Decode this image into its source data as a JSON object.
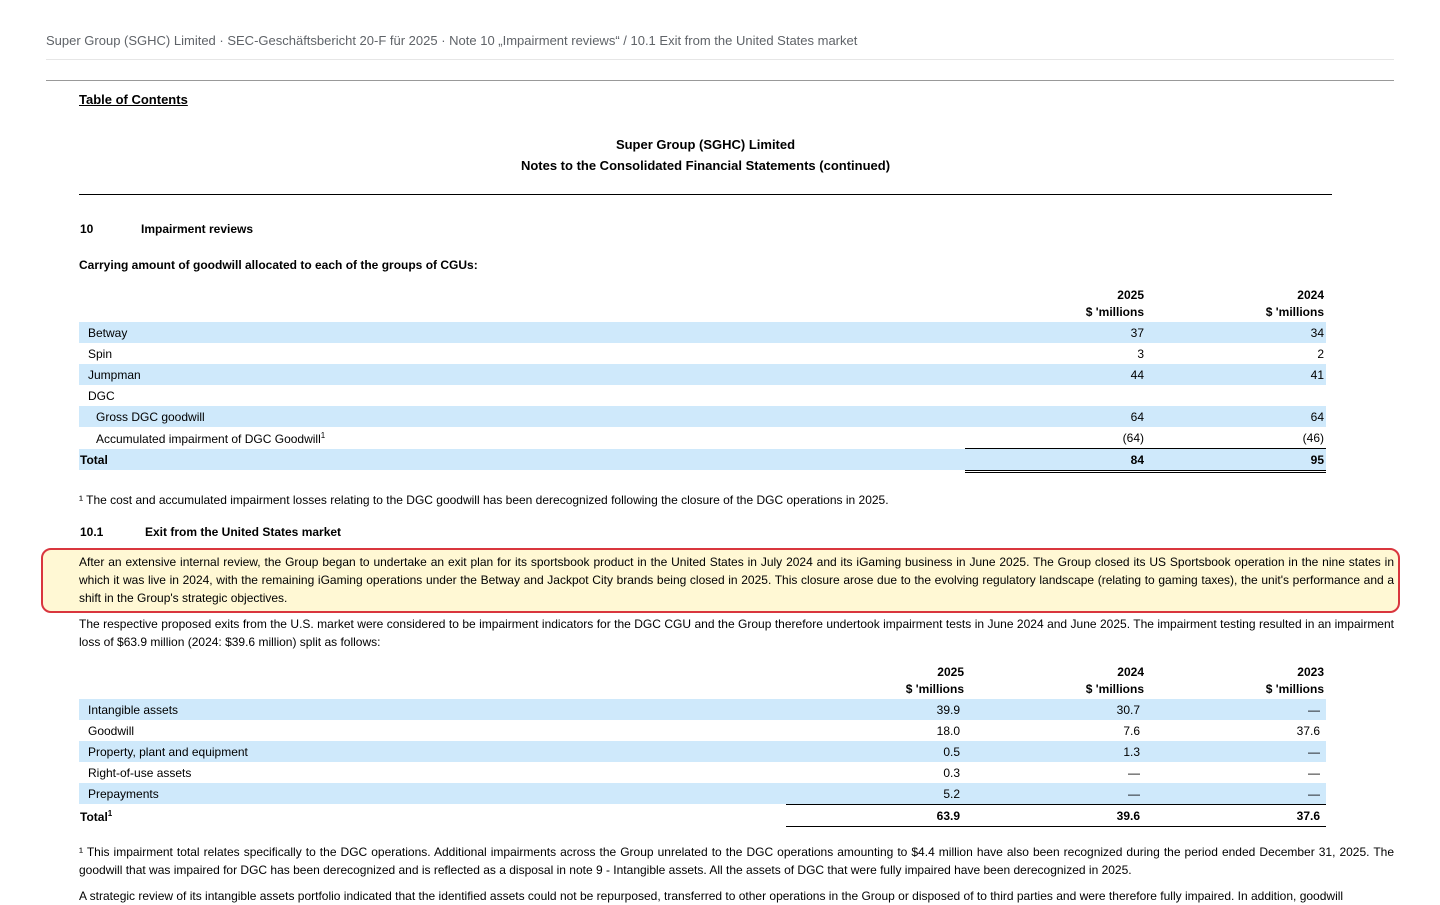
{
  "header": {
    "breadcrumb": "Super Group (SGHC) Limited · SEC-Geschäftsbericht 20-F für 2025 · Note 10 „Impairment reviews“ / 10.1 Exit from the United States market"
  },
  "document": {
    "toc_link": "Table of Contents",
    "title_line1": "Super Group (SGHC) Limited",
    "title_line2": "Notes to the Consolidated Financial Statements (continued)",
    "section_number": "10",
    "section_title": "Impairment reviews",
    "goodwill_caption": "Carrying amount of goodwill allocated to each of the groups of CGUs:",
    "goodwill_table": {
      "columns": [
        {
          "year": "2025",
          "unit": "$ 'millions"
        },
        {
          "year": "2024",
          "unit": "$ 'millions"
        }
      ],
      "rows": [
        {
          "label": "Betway",
          "v2025": "37",
          "v2024": "34"
        },
        {
          "label": "Spin",
          "v2025": "3",
          "v2024": "2"
        },
        {
          "label": "Jumpman",
          "v2025": "44",
          "v2024": "41"
        },
        {
          "label": "DGC",
          "v2025": "",
          "v2024": ""
        },
        {
          "label": "Gross DGC goodwill",
          "v2025": "64",
          "v2024": "64"
        },
        {
          "label": "Accumulated impairment of DGC Goodwill",
          "sup": "1",
          "v2025": "(64)",
          "v2024": "(46)"
        },
        {
          "label": "Total",
          "v2025": "84",
          "v2024": "95"
        }
      ]
    },
    "goodwill_footnote": "¹ The cost and accumulated impairment losses relating to the DGC goodwill has been derecognized following the closure of the DGC operations in 2025.",
    "subsection_number": "10.1",
    "subsection_title": "Exit from the United States market",
    "highlighted_paragraph": "After an extensive internal review, the Group began to undertake an exit plan for its sportsbook product in the United States in July 2024 and its iGaming business in June 2025. The Group closed its US Sportsbook operation in the nine states in which it was live in 2024, with the remaining iGaming operations under the Betway and Jackpot City brands being closed in 2025. This closure arose due to the evolving regulatory landscape (relating to gaming taxes), the unit's performance and a shift in the Group's strategic objectives.",
    "paragraph_2": "The respective proposed exits from the U.S. market were considered to be impairment indicators for the DGC CGU and the Group therefore undertook impairment tests in June 2024 and June 2025. The impairment testing resulted in an impairment loss of $63.9 million (2024: $39.6 million) split as follows:",
    "impairment_table": {
      "columns": [
        {
          "year": "2025",
          "unit": "$ 'millions"
        },
        {
          "year": "2024",
          "unit": "$ 'millions"
        },
        {
          "year": "2023",
          "unit": "$ 'millions"
        }
      ],
      "rows": [
        {
          "label": "Intangible assets",
          "v2025": "39.9",
          "v2024": "30.7",
          "v2023": "—"
        },
        {
          "label": "Goodwill",
          "v2025": "18.0",
          "v2024": "7.6",
          "v2023": "37.6"
        },
        {
          "label": "Property, plant and equipment",
          "v2025": "0.5",
          "v2024": "1.3",
          "v2023": "—"
        },
        {
          "label": "Right-of-use assets",
          "v2025": "0.3",
          "v2024": "—",
          "v2023": "—"
        },
        {
          "label": "Prepayments",
          "v2025": "5.2",
          "v2024": "—",
          "v2023": "—"
        },
        {
          "label": "Total",
          "sup": "1",
          "v2025": "63.9",
          "v2024": "39.6",
          "v2023": "37.6"
        }
      ]
    },
    "impairment_footnote": "¹ This impairment total relates specifically to the DGC operations. Additional impairments across the Group unrelated to the DGC operations amounting to $4.4 million have also been recognized during the period ended December 31, 2025. The goodwill that was impaired for DGC has been derecognized and is reflected as a disposal in note 9 - Intangible assets. All the assets of DGC that were fully impaired have been derecognized in 2025.",
    "paragraph_3": "A strategic review of its intangible assets portfolio indicated that the identified assets could not be repurposed, transferred to other operations in the Group or disposed of to third parties and were therefore fully impaired. In addition, goodwill"
  },
  "colors": {
    "row_shade": "#cfe9fb",
    "highlight_fill": "#fff8d4",
    "highlight_border": "#d9363e"
  }
}
